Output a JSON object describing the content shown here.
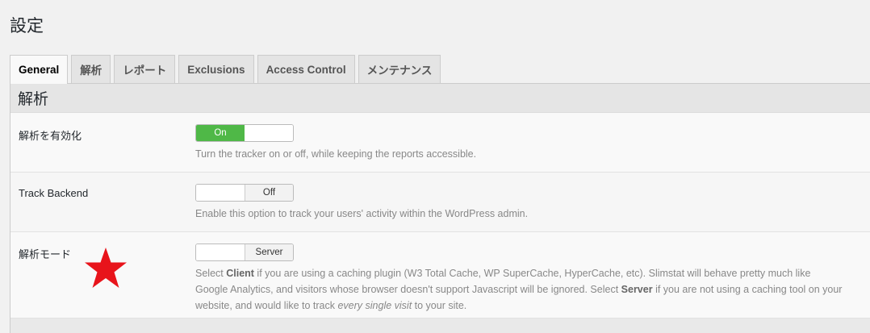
{
  "page": {
    "title": "設定"
  },
  "tabs": [
    {
      "label": "General",
      "active": true
    },
    {
      "label": "解析"
    },
    {
      "label": "レポート"
    },
    {
      "label": "Exclusions"
    },
    {
      "label": "Access Control"
    },
    {
      "label": "メンテナンス"
    }
  ],
  "section": {
    "title": "解析"
  },
  "settings": [
    {
      "label": "解析を有効化",
      "toggle_state": "On",
      "description": "Turn the tracker on or off, while keeping the reports accessible."
    },
    {
      "label": "Track Backend",
      "toggle_state": "Off",
      "description": "Enable this option to track your users' activity within the WordPress admin."
    },
    {
      "label": "解析モード",
      "toggle_state": "Server",
      "description_parts": {
        "p1": "Select ",
        "client": "Client",
        "p2": " if you are using a caching plugin (W3 Total Cache, WP SuperCache, HyperCache, etc). Slimstat will behave pretty much like Google Analytics, and visitors whose browser doesn't support Javascript will be ignored. Select ",
        "server": "Server",
        "p3": " if you are not using a caching tool on your website, and would like to track ",
        "every": "every single visit",
        "p4": " to your site."
      }
    }
  ],
  "annotation": {
    "icon": "star-icon",
    "color": "#e8141b"
  },
  "colors": {
    "toggle_on": "#4fb847",
    "annotation": "#e8141b"
  }
}
